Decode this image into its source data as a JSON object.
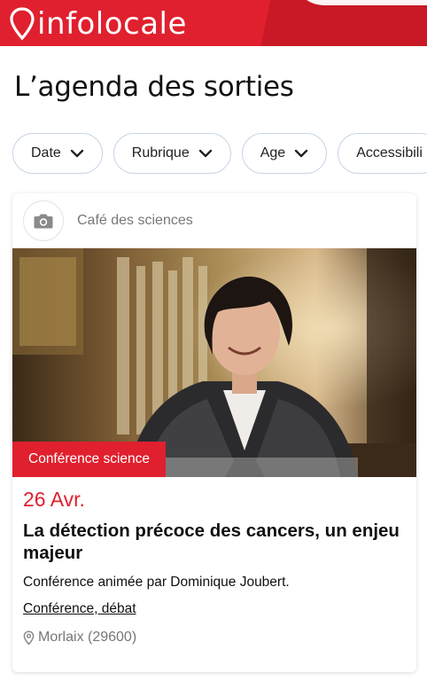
{
  "header": {
    "logo_text": "infolocale"
  },
  "page": {
    "title": "L’agenda des sorties"
  },
  "filters": [
    {
      "label": "Date"
    },
    {
      "label": "Rubrique"
    },
    {
      "label": "Age"
    },
    {
      "label": "Accessibili"
    }
  ],
  "event": {
    "source": "Café des sciences",
    "category": "Conférence science",
    "date": "26 Avr.",
    "title": "La détection précoce des cancers, un enjeu majeur",
    "description": "Conférence animée par Dominique Joubert.",
    "type": "Conférence, débat",
    "location": "Morlaix (29600)"
  },
  "colors": {
    "brand_red": "#e0202e",
    "chip_border": "#c9d6e6",
    "muted_text": "#777777"
  },
  "icons": [
    "location-pin-icon",
    "camera-icon",
    "chevron-down-icon",
    "map-pin-icon"
  ]
}
